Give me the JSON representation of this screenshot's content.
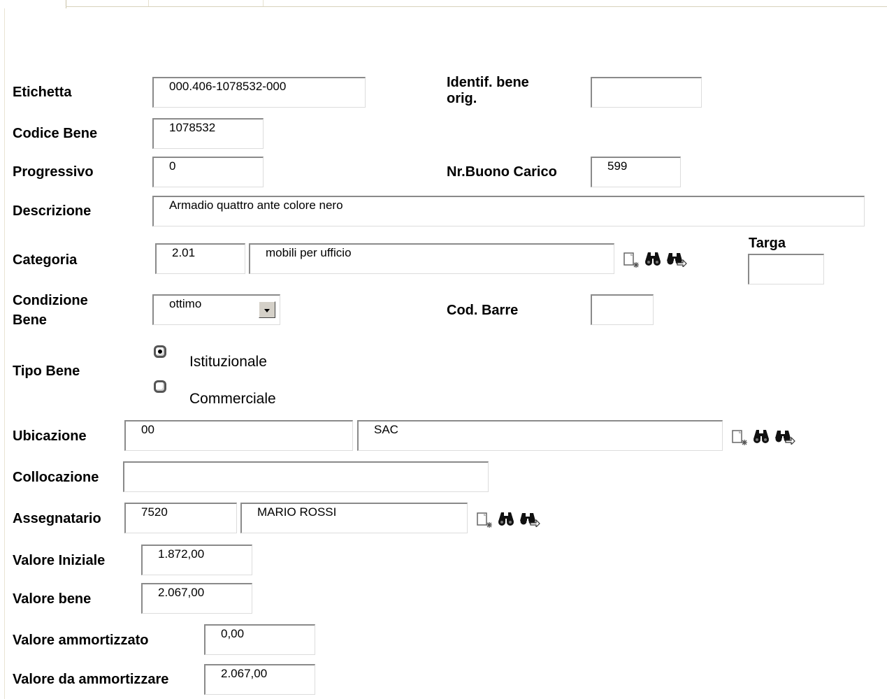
{
  "form": {
    "etichetta": {
      "label": "Etichetta",
      "value": "000.406-1078532-000"
    },
    "identif_bene_orig": {
      "label_line1": "Identif. bene",
      "label_line2": "orig.",
      "value": ""
    },
    "codice_bene": {
      "label": "Codice Bene",
      "value": "1078532"
    },
    "progressivo": {
      "label": "Progressivo",
      "value": "0"
    },
    "nr_buono_carico": {
      "label": "Nr.Buono Carico",
      "value": "599"
    },
    "descrizione": {
      "label": "Descrizione",
      "value": "Armadio quattro ante colore nero"
    },
    "categoria": {
      "label": "Categoria",
      "code": "2.01",
      "name": "mobili per ufficio"
    },
    "targa": {
      "label": "Targa",
      "value": ""
    },
    "condizione_bene": {
      "label_line1": "Condizione",
      "label_line2": "Bene",
      "selected": "ottimo"
    },
    "cod_barre": {
      "label": "Cod. Barre",
      "value": ""
    },
    "tipo_bene": {
      "label": "Tipo Bene",
      "options": [
        {
          "label": "Istituzionale",
          "checked": true
        },
        {
          "label": "Commerciale",
          "checked": false
        }
      ]
    },
    "ubicazione": {
      "label": "Ubicazione",
      "code": "00",
      "name": "SAC"
    },
    "collocazione": {
      "label": "Collocazione",
      "value": ""
    },
    "assegnatario": {
      "label": "Assegnatario",
      "code": "7520",
      "name": "MARIO ROSSI"
    },
    "valore_iniziale": {
      "label": "Valore Iniziale",
      "value": "1.872,00"
    },
    "valore_bene": {
      "label": "Valore bene",
      "value": "2.067,00"
    },
    "valore_ammortizzato": {
      "label": "Valore ammortizzato",
      "value": "0,00"
    },
    "valore_da_ammortizzare": {
      "label": "Valore da ammortizzare",
      "value": "2.067,00"
    }
  },
  "icons": [
    "new-document-icon",
    "binoculars-search-icon",
    "lookup-arrows-icon"
  ]
}
